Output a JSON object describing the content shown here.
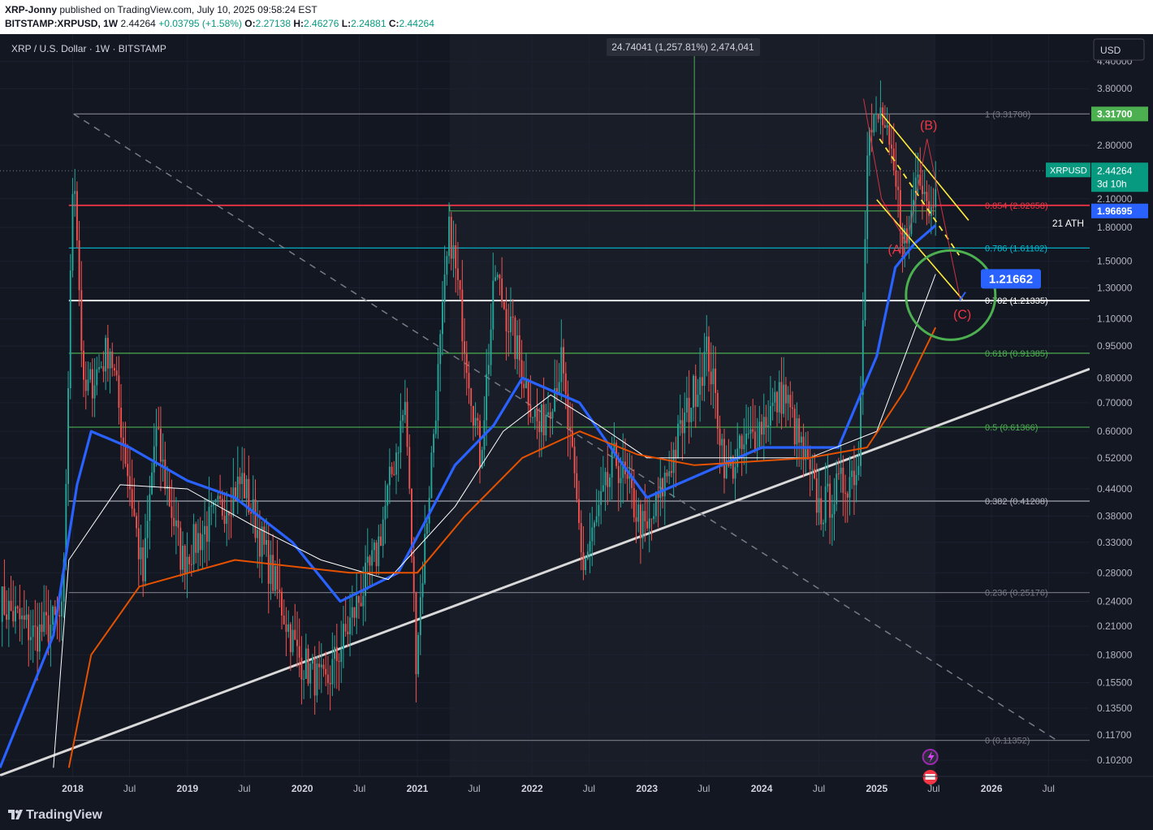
{
  "header": {
    "author": "XRP-Jonny",
    "published_text": "published on TradingView.com, July 10, 2025 09:58:24 EST",
    "symbol_line": "BITSTAMP:XRPUSD, 1W",
    "quote": {
      "last": "2.44264",
      "change": "+0.03795 (+1.58%)",
      "o_label": "O:",
      "o": "2.27138",
      "h_label": "H:",
      "h": "2.46276",
      "l_label": "L:",
      "l": "2.24881",
      "c_label": "C:",
      "c": "2.44264"
    }
  },
  "chart_title": "XRP / U.S. Dollar · 1W · BITSTAMP",
  "currency_button": "USD",
  "measure_label": "24.74041 (1,257.81%) 2,474,041",
  "footer_logo": "TradingView",
  "colors": {
    "background": "#131722",
    "up": "#26a69a",
    "down": "#ef5350",
    "ma_blue": "#2962ff",
    "ma_orange": "#e65100",
    "trendline": "#d9d9d9",
    "channel": "#ffeb3b",
    "target_circle": "#4caf50",
    "wave_labels": "#f23645"
  },
  "chart_data": {
    "type": "line",
    "symbol": "XRPUSD",
    "interval": "1W",
    "exchange": "BITSTAMP",
    "y_scale": "log",
    "ylim": [
      0.0935,
      5.1
    ],
    "xlim": [
      "2017-05-15",
      "2026-11-09"
    ],
    "x_ticks": [
      {
        "date": "2018-01-01",
        "label": "2018",
        "bold": true
      },
      {
        "date": "2018-07-01",
        "label": "Jul",
        "bold": false
      },
      {
        "date": "2019-01-01",
        "label": "2019",
        "bold": true
      },
      {
        "date": "2019-07-01",
        "label": "Jul",
        "bold": false
      },
      {
        "date": "2020-01-01",
        "label": "2020",
        "bold": true
      },
      {
        "date": "2020-07-01",
        "label": "Jul",
        "bold": false
      },
      {
        "date": "2021-01-01",
        "label": "2021",
        "bold": true
      },
      {
        "date": "2021-07-01",
        "label": "Jul",
        "bold": false
      },
      {
        "date": "2022-01-01",
        "label": "2022",
        "bold": true
      },
      {
        "date": "2022-07-01",
        "label": "Jul",
        "bold": false
      },
      {
        "date": "2023-01-01",
        "label": "2023",
        "bold": true
      },
      {
        "date": "2023-07-01",
        "label": "Jul",
        "bold": false
      },
      {
        "date": "2024-01-01",
        "label": "2024",
        "bold": true
      },
      {
        "date": "2024-07-01",
        "label": "Jul",
        "bold": false
      },
      {
        "date": "2025-01-01",
        "label": "2025",
        "bold": true
      },
      {
        "date": "2025-07-01",
        "label": "Jul",
        "bold": false
      },
      {
        "date": "2026-01-01",
        "label": "2026",
        "bold": true
      },
      {
        "date": "2026-07-01",
        "label": "Jul",
        "bold": false
      }
    ],
    "y_ticks": [
      {
        "value": 4.4,
        "label": "4.40000"
      },
      {
        "value": 3.8,
        "label": "3.80000"
      },
      {
        "value": 2.8,
        "label": "2.80000"
      },
      {
        "value": 2.1,
        "label": "2.10000"
      },
      {
        "value": 1.8,
        "label": "1.80000"
      },
      {
        "value": 1.5,
        "label": "1.50000"
      },
      {
        "value": 1.3,
        "label": "1.30000"
      },
      {
        "value": 1.1,
        "label": "1.10000"
      },
      {
        "value": 0.95,
        "label": "0.95000"
      },
      {
        "value": 0.8,
        "label": "0.80000"
      },
      {
        "value": 0.7,
        "label": "0.70000"
      },
      {
        "value": 0.6,
        "label": "0.60000"
      },
      {
        "value": 0.52,
        "label": "0.52000"
      },
      {
        "value": 0.44,
        "label": "0.44000"
      },
      {
        "value": 0.38,
        "label": "0.38000"
      },
      {
        "value": 0.33,
        "label": "0.33000"
      },
      {
        "value": 0.28,
        "label": "0.28000"
      },
      {
        "value": 0.24,
        "label": "0.24000"
      },
      {
        "value": 0.21,
        "label": "0.21000"
      },
      {
        "value": 0.18,
        "label": "0.18000"
      },
      {
        "value": 0.155,
        "label": "0.15500"
      },
      {
        "value": 0.135,
        "label": "0.13500"
      },
      {
        "value": 0.117,
        "label": "0.11700"
      },
      {
        "value": 0.102,
        "label": "0.10200"
      }
    ],
    "price_path": [
      [
        "2017-05-15",
        0.24
      ],
      [
        "2017-09-01",
        0.2
      ],
      [
        "2017-12-01",
        0.22
      ],
      [
        "2018-01-04",
        2.8
      ],
      [
        "2018-02-05",
        0.72
      ],
      [
        "2018-04-30",
        0.95
      ],
      [
        "2018-08-13",
        0.27
      ],
      [
        "2018-09-21",
        0.6
      ],
      [
        "2018-12-14",
        0.3
      ],
      [
        "2019-06-24",
        0.46
      ],
      [
        "2019-12-16",
        0.18
      ],
      [
        "2020-03-12",
        0.15
      ],
      [
        "2020-08-24",
        0.31
      ],
      [
        "2020-11-24",
        0.7
      ],
      [
        "2020-12-28",
        0.18
      ],
      [
        "2021-04-14",
        1.8
      ],
      [
        "2021-07-20",
        0.52
      ],
      [
        "2021-09-06",
        1.4
      ],
      [
        "2022-01-24",
        0.6
      ],
      [
        "2022-04-04",
        0.86
      ],
      [
        "2022-06-13",
        0.29
      ],
      [
        "2022-09-23",
        0.52
      ],
      [
        "2022-12-30",
        0.34
      ],
      [
        "2023-07-13",
        0.93
      ],
      [
        "2023-09-11",
        0.48
      ],
      [
        "2024-03-11",
        0.74
      ],
      [
        "2024-07-05",
        0.39
      ],
      [
        "2024-11-04",
        0.5
      ],
      [
        "2024-12-02",
        2.9
      ],
      [
        "2025-01-16",
        3.317
      ],
      [
        "2025-04-07",
        1.6
      ],
      [
        "2025-05-12",
        2.6
      ],
      [
        "2025-06-23",
        1.95
      ],
      [
        "2025-07-07",
        2.44264
      ]
    ],
    "moving_averages": [
      {
        "color": "#2962ff",
        "points": [
          [
            "2017-05-15",
            0.098
          ],
          [
            "2017-11-01",
            0.2
          ],
          [
            "2018-01-15",
            0.45
          ],
          [
            "2018-03-01",
            0.6
          ],
          [
            "2018-07-01",
            0.55
          ],
          [
            "2019-01-01",
            0.46
          ],
          [
            "2019-06-01",
            0.42
          ],
          [
            "2019-12-01",
            0.33
          ],
          [
            "2020-05-01",
            0.24
          ],
          [
            "2020-11-01",
            0.28
          ],
          [
            "2021-05-01",
            0.5
          ],
          [
            "2021-09-01",
            0.62
          ],
          [
            "2021-12-01",
            0.8
          ],
          [
            "2022-06-01",
            0.7
          ],
          [
            "2022-10-01",
            0.52
          ],
          [
            "2023-01-01",
            0.42
          ],
          [
            "2023-07-01",
            0.48
          ],
          [
            "2024-01-01",
            0.55
          ],
          [
            "2024-09-01",
            0.55
          ],
          [
            "2025-01-01",
            0.9
          ],
          [
            "2025-03-01",
            1.45
          ],
          [
            "2025-05-01",
            1.65
          ],
          [
            "2025-07-07",
            1.82
          ]
        ]
      },
      {
        "color": "#ffffff",
        "points": [
          [
            "2017-11-01",
            0.098
          ],
          [
            "2017-12-20",
            0.3
          ],
          [
            "2018-06-01",
            0.45
          ],
          [
            "2019-01-01",
            0.44
          ],
          [
            "2019-08-01",
            0.36
          ],
          [
            "2020-03-01",
            0.3
          ],
          [
            "2020-10-01",
            0.27
          ],
          [
            "2021-05-01",
            0.4
          ],
          [
            "2021-10-01",
            0.6
          ],
          [
            "2022-03-01",
            0.73
          ],
          [
            "2022-08-01",
            0.62
          ],
          [
            "2023-01-01",
            0.52
          ],
          [
            "2023-07-01",
            0.52
          ],
          [
            "2024-06-01",
            0.52
          ],
          [
            "2025-01-01",
            0.6
          ],
          [
            "2025-07-07",
            1.4
          ]
        ]
      },
      {
        "color": "#e65100",
        "points": [
          [
            "2017-12-20",
            0.098
          ],
          [
            "2018-03-01",
            0.18
          ],
          [
            "2018-08-01",
            0.26
          ],
          [
            "2019-06-01",
            0.3
          ],
          [
            "2020-06-01",
            0.28
          ],
          [
            "2021-01-01",
            0.28
          ],
          [
            "2021-06-01",
            0.38
          ],
          [
            "2021-12-01",
            0.52
          ],
          [
            "2022-06-01",
            0.6
          ],
          [
            "2022-12-01",
            0.53
          ],
          [
            "2023-06-01",
            0.5
          ],
          [
            "2024-06-01",
            0.52
          ],
          [
            "2024-12-01",
            0.55
          ],
          [
            "2025-04-01",
            0.75
          ],
          [
            "2025-07-07",
            1.05
          ]
        ]
      }
    ],
    "horizontal_levels": [
      {
        "value": 3.317,
        "label": "1 (3.31700)",
        "color": "#787b86"
      },
      {
        "value": 2.02658,
        "label": "0.854 (2.02658)",
        "color": "#f23645"
      },
      {
        "value": 1.61102,
        "label": "0.786 (1.61102)",
        "color": "#00bcd4"
      },
      {
        "value": 1.21335,
        "label": "0.702 (1.21335)",
        "color": "#ffffff"
      },
      {
        "value": 0.91385,
        "label": "0.618 (0.91385)",
        "color": "#4caf50"
      },
      {
        "value": 0.61366,
        "label": "0.5 (0.61366)",
        "color": "#4caf50"
      },
      {
        "value": 0.41208,
        "label": "0.382 (0.41208)",
        "color": "#b2b5be"
      },
      {
        "value": 0.25176,
        "label": "0.236 (0.25176)",
        "color": "#787b86"
      },
      {
        "value": 0.11352,
        "label": "0 (0.11352)",
        "color": "#787b86"
      }
    ],
    "price_tags": [
      {
        "value": 3.317,
        "label": "3.31700",
        "color": "#4caf50"
      },
      {
        "value": 2.44264,
        "symbol": "XRPUSD",
        "label": "2.44264",
        "countdown": "3d 10h",
        "color": "#089981"
      },
      {
        "value": 1.96695,
        "label": "1.96695",
        "color": "#2962ff"
      }
    ],
    "annotations": {
      "ath_label": "21 ATH",
      "target_label": "1.21662",
      "target_value": 1.21662,
      "wave_a": "(A)",
      "wave_b": "(B)",
      "wave_c": "(C)"
    }
  }
}
